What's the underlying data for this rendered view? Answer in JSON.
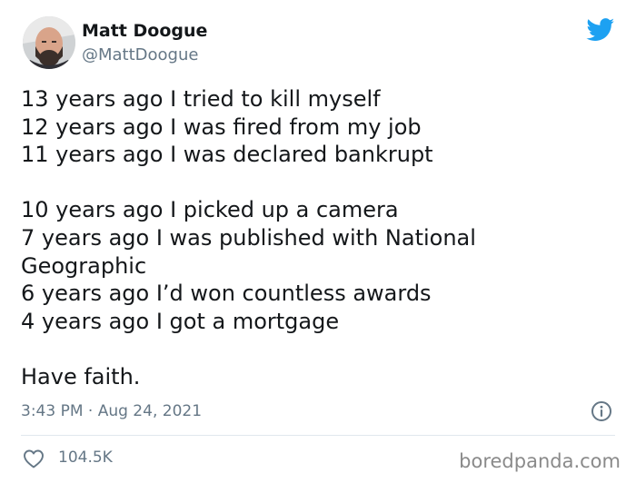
{
  "author": {
    "display_name": "Matt Doogue",
    "handle": "@MattDoogue",
    "avatar_icon": "avatar-photo"
  },
  "platform_icon": "twitter-bird-icon",
  "tweet": {
    "lines_group1": [
      "13 years ago I tried to kill myself",
      "12 years ago I was fired from my job",
      "11 years ago I was declared bankrupt"
    ],
    "lines_group2": [
      "10 years ago I picked up a camera",
      "7 years ago I was published with National",
      "Geographic",
      "6 years ago I’d won countless awards",
      "4 years ago I got a mortgage"
    ],
    "closing": "Have faith."
  },
  "meta": {
    "timestamp": "3:43 PM · Aug 24, 2021",
    "likes": "104.5K"
  },
  "watermark": "boredpanda.com",
  "colors": {
    "twitter_blue": "#1da1f2",
    "text_primary": "#14171a",
    "text_secondary": "#657786",
    "divider": "#e1e8ed"
  }
}
